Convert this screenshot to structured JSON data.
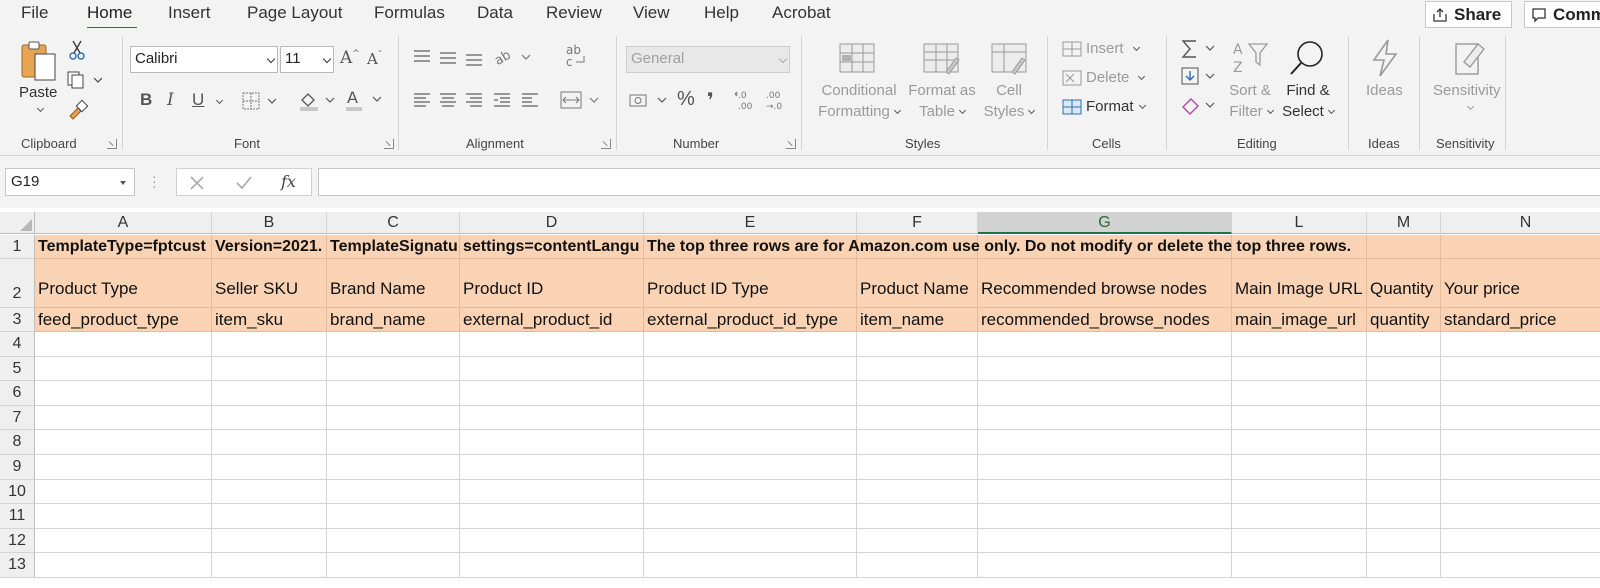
{
  "menu": {
    "tabs": [
      "File",
      "Home",
      "Insert",
      "Page Layout",
      "Formulas",
      "Data",
      "Review",
      "View",
      "Help",
      "Acrobat"
    ],
    "active_tab": "Home",
    "share_label": "Share",
    "comments_label": "Comm"
  },
  "ribbon": {
    "clipboard": {
      "paste_label": "Paste",
      "group_label": "Clipboard"
    },
    "font": {
      "font_name": "Calibri",
      "font_size": "11",
      "group_label": "Font",
      "bold": "B",
      "italic": "I",
      "underline": "U"
    },
    "alignment": {
      "group_label": "Alignment"
    },
    "number": {
      "format": "General",
      "group_label": "Number",
      "percent": "%",
      "comma": "❜"
    },
    "styles": {
      "conditional_1": "Conditional",
      "conditional_2": "Formatting",
      "format_table_1": "Format as",
      "format_table_2": "Table",
      "cell_styles_1": "Cell",
      "cell_styles_2": "Styles",
      "group_label": "Styles"
    },
    "cells": {
      "insert": "Insert",
      "delete": "Delete",
      "format": "Format",
      "group_label": "Cells"
    },
    "editing": {
      "sort_1": "Sort &",
      "sort_2": "Filter",
      "find_1": "Find &",
      "find_2": "Select",
      "group_label": "Editing"
    },
    "ideas": {
      "label": "Ideas",
      "group_label": "Ideas"
    },
    "sensitivity": {
      "label": "Sensitivity",
      "group_label": "Sensitivity"
    }
  },
  "formula_bar": {
    "name_box": "G19",
    "fx": "fx",
    "content": ""
  },
  "sheet": {
    "selected_column": "G",
    "columns": [
      "A",
      "B",
      "C",
      "D",
      "E",
      "F",
      "G",
      "L",
      "M",
      "N"
    ],
    "row_numbers": [
      "1",
      "2",
      "3",
      "4",
      "5",
      "6",
      "7",
      "8",
      "9",
      "10",
      "11",
      "12",
      "13"
    ],
    "row1": [
      "TemplateType=fptcust",
      "Version=2021.",
      "TemplateSignatu",
      "settings=contentLangu",
      "The top three rows are for Amazon.com use only. Do not modify or delete the top three rows."
    ],
    "row2": [
      "Product Type",
      "Seller SKU",
      "Brand Name",
      "Product ID",
      "Product ID Type",
      "Product Name",
      "Recommended browse nodes",
      "Main Image URL",
      "Quantity",
      "Your price"
    ],
    "row3": [
      "feed_product_type",
      "item_sku",
      "brand_name",
      "external_product_id",
      "external_product_id_type",
      "item_name",
      "recommended_browse_nodes",
      "main_image_url",
      "quantity",
      "standard_price"
    ]
  },
  "colors": {
    "header_fill": "#fad3b4",
    "accent": "#217346"
  }
}
